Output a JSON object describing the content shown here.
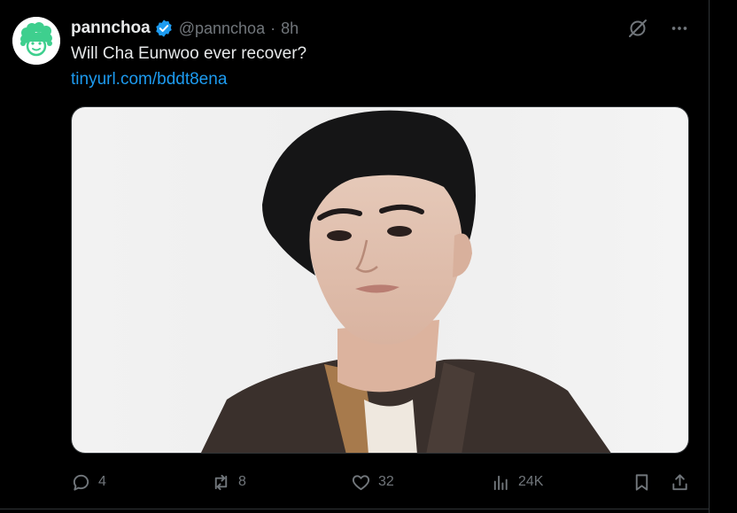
{
  "tweet": {
    "display_name": "pannchoa",
    "handle": "@pannchoa",
    "separator": "·",
    "time": "8h",
    "text": "Will Cha Eunwoo ever recover?",
    "link": "tinyurl.com/bddt8ena"
  },
  "header_actions": {
    "grok_icon": "grok-icon",
    "more_icon": "more-icon"
  },
  "media": {
    "kind": "photo"
  },
  "actions": {
    "reply_count": "4",
    "retweet_count": "8",
    "like_count": "32",
    "views_count": "24K"
  },
  "colors": {
    "background": "#000000",
    "text": "#e7e9ea",
    "secondary": "#71767b",
    "link": "#1d9bf0",
    "avatar_accent": "#3ecf8e"
  }
}
